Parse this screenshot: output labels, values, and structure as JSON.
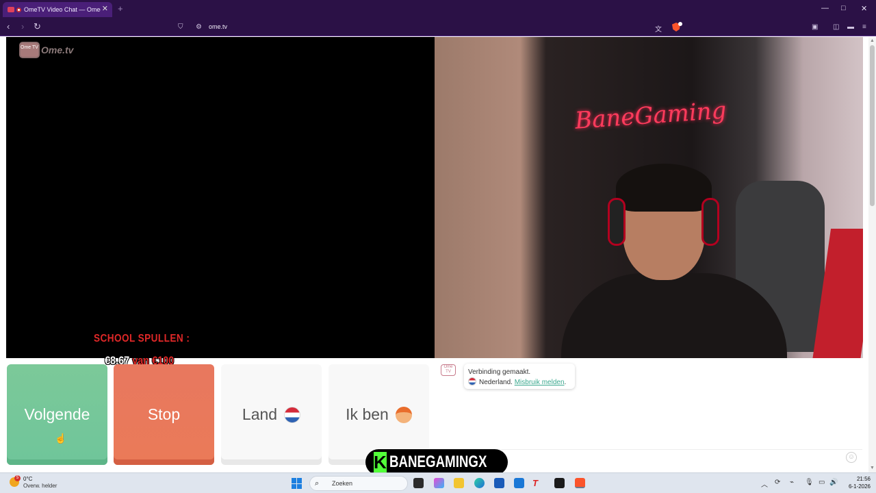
{
  "browser": {
    "tab_title": "OmeTV Video Chat — Omeg",
    "tab_close": "✕",
    "new_tab": "+",
    "url": "ome.tv",
    "window_controls": {
      "minimize": "—",
      "maximize": "□",
      "close": "✕"
    }
  },
  "page": {
    "logo_text": "Ome.tv",
    "logo_badge": "Ome TV",
    "video_overlay": {
      "line1": "SCHOOL SPULLEN :",
      "amount": "€8,67",
      "connector": "van",
      "target": "€100"
    },
    "neon_sign": "BaneGaming",
    "buttons": {
      "next": "Volgende",
      "stop": "Stop",
      "country": "Land",
      "gender": "Ik ben"
    },
    "chat": {
      "logo": "Ome TV",
      "status": "Verbinding gemaakt.",
      "country": "Nederland.",
      "report_link": "Misbruik melden",
      "after_link": ".",
      "emoji": "☺"
    },
    "stream_badge": {
      "logo_letter": "K",
      "name": "BANEGAMINGX"
    }
  },
  "taskbar": {
    "weather_badge": "5",
    "temperature": "0°C",
    "condition": "Overw. helder",
    "search_placeholder": "Zoeken",
    "time": "21:56",
    "date": "6-1-2026"
  },
  "colors": {
    "browser_chrome": "#2b1146",
    "next_button": "#72c69a",
    "stop_button": "#e8785f",
    "link": "#3aa88e"
  }
}
